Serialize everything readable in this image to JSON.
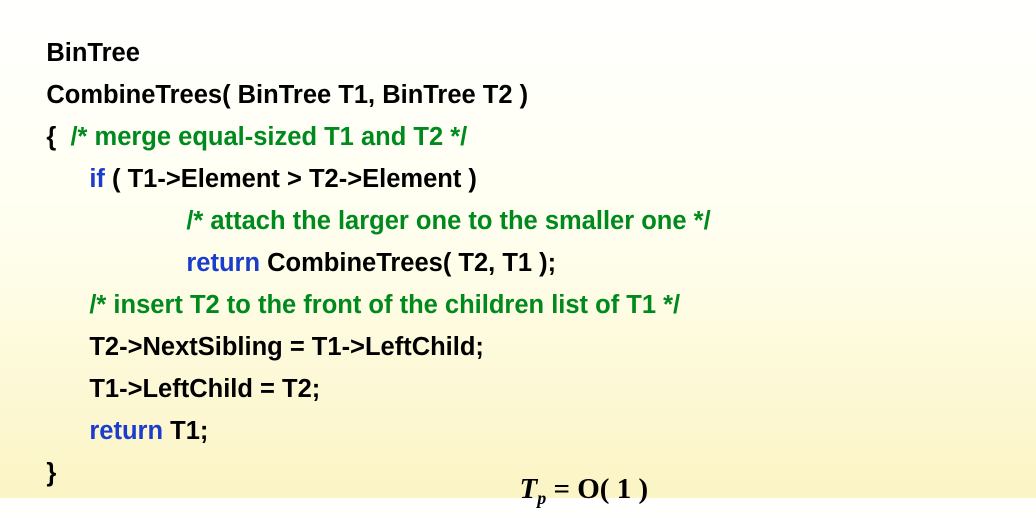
{
  "code": {
    "lines": [
      {
        "indent": "",
        "parts": [
          {
            "type": "plain",
            "text": "BinTree"
          }
        ]
      },
      {
        "indent": "",
        "parts": [
          {
            "type": "plain",
            "text": "CombineTrees( BinTree T1, BinTree T2 )"
          }
        ]
      },
      {
        "indent": "",
        "parts": [
          {
            "type": "plain",
            "text": "{  "
          },
          {
            "type": "comment",
            "text": "/* merge equal-sized T1 and T2 */"
          }
        ]
      },
      {
        "indent": "level1",
        "parts": [
          {
            "type": "keyword",
            "text": "if"
          },
          {
            "type": "plain",
            "text": " ( T1->Element > T2->Element )"
          }
        ]
      },
      {
        "indent": "level2",
        "parts": [
          {
            "type": "comment",
            "text": "/* attach the larger one to the smaller one */"
          }
        ]
      },
      {
        "indent": "level2",
        "parts": [
          {
            "type": "keyword",
            "text": "return"
          },
          {
            "type": "plain",
            "text": " CombineTrees( T2, T1 );"
          }
        ]
      },
      {
        "indent": "level1",
        "parts": [
          {
            "type": "comment",
            "text": "/* insert T2 to the front of the children list of T1 */"
          }
        ]
      },
      {
        "indent": "level1",
        "parts": [
          {
            "type": "plain",
            "text": "T2->NextSibling = T1->LeftChild;"
          }
        ]
      },
      {
        "indent": "level1",
        "parts": [
          {
            "type": "plain",
            "text": "T1->LeftChild = T2;"
          }
        ]
      },
      {
        "indent": "level1",
        "parts": [
          {
            "type": "keyword",
            "text": "return"
          },
          {
            "type": "plain",
            "text": " T1;"
          }
        ]
      },
      {
        "indent": "",
        "parts": [
          {
            "type": "plain",
            "text": "}"
          }
        ]
      }
    ]
  },
  "formula": {
    "var": "T",
    "sub": "p",
    "rhs": " = O( 1 )"
  },
  "colors": {
    "keyword": "#1b3ccc",
    "comment": "#008a1e",
    "text": "#000000"
  }
}
